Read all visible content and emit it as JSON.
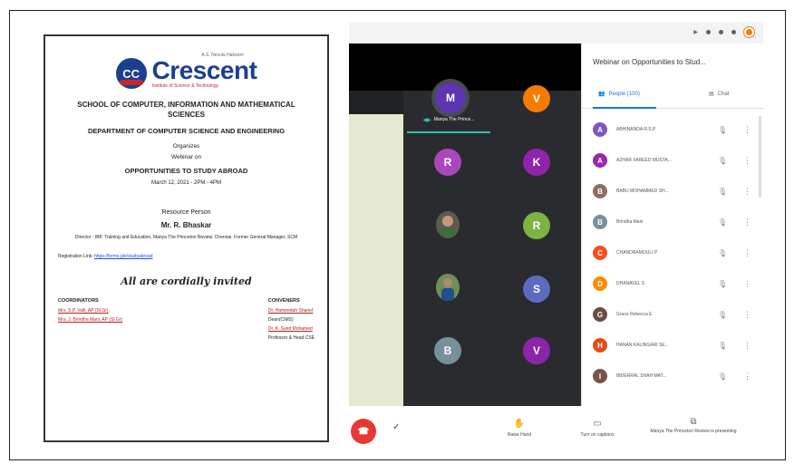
{
  "poster": {
    "logo_small": "A.S. Nevula Hakeem",
    "logo_name": "Crescent",
    "logo_sub": "Institute of Science & Technology",
    "school": "SCHOOL OF COMPUTER, INFORMATION AND MATHEMATICAL SCIENCES",
    "department": "DEPARTMENT OF COMPUTER SCIENCE AND ENGINEERING",
    "organizes": "Organizes",
    "webinar_on": "Webinar on",
    "webinar_title": "OPPORTUNITIES TO STUDY ABROAD",
    "date": "March 12, 2021 - 2PM - 4PM",
    "resource_person_label": "Resource Person",
    "resource_person_name": "Mr. R. Bhaskar",
    "resource_person_desc": "Director - IBP, Training and Education, Manya The Princeton Review, Chennai. Former General Manager, SCM",
    "registration_label": "Registration Link:",
    "registration_link": "https://forms.gle/studyabroad",
    "invite": "All are cordially invited",
    "coordinators_label": "COORDINATORS",
    "coordinators": [
      "Mrs. S.P. Valli, AP (Sl.Gr)",
      "Mrs. J. Brindha Mani, AP (Sl.Gr)"
    ],
    "convenors_label": "CONVENERS",
    "convenors": [
      "Dr. Hameedah Sharief",
      "Dean(CIMS)",
      "Dr. K. Syed Mohamed",
      "Professor & Head CSE"
    ]
  },
  "meet": {
    "side_title": "Webinar on Opportunities to Stud...",
    "tab_people": "People (100)",
    "tab_chat": "Chat",
    "presenter_label": "Manya The Prince...",
    "participants": [
      {
        "initial": "A",
        "name": "ABHINANDA R.S.P",
        "color": "#7e57c2"
      },
      {
        "initial": "A",
        "name": "AZHAR FAREED MUSTA...",
        "color": "#9c27b0"
      },
      {
        "initial": "B",
        "name": "BABU MOHAMMED SH...",
        "color": "#8d6e63"
      },
      {
        "initial": "B",
        "name": "Brindha Mani",
        "color": "#78909c"
      },
      {
        "initial": "C",
        "name": "CHANDRAMOULI P",
        "color": "#f4511e"
      },
      {
        "initial": "D",
        "name": "DHANAVEL S",
        "color": "#fb8c00"
      },
      {
        "initial": "G",
        "name": "Grace Rebecca E",
        "color": "#6d4c41"
      },
      {
        "initial": "H",
        "name": "HANAN KALINGARI SE...",
        "color": "#e64a19"
      },
      {
        "initial": "I",
        "name": "IBDERRAL SHAH MAT...",
        "color": "#795548"
      }
    ],
    "tiles": [
      {
        "initial": "M",
        "color": "#5e35b1"
      },
      {
        "initial": "V",
        "color": "#f57c00"
      },
      {
        "initial": "R",
        "color": "#ab47bc"
      },
      {
        "initial": "K",
        "color": "#8e24aa"
      },
      {
        "initial": "R",
        "color": "#7cb342"
      },
      {
        "initial": "S",
        "color": "#5c6bc0"
      },
      {
        "initial": "B",
        "color": "#78909c"
      },
      {
        "initial": "V",
        "color": "#8e24aa"
      }
    ],
    "controls": {
      "raise_hand": "Raise Hand",
      "captions": "Turn on captions",
      "presenting": "Manya The Princeton Review is presenting"
    }
  }
}
